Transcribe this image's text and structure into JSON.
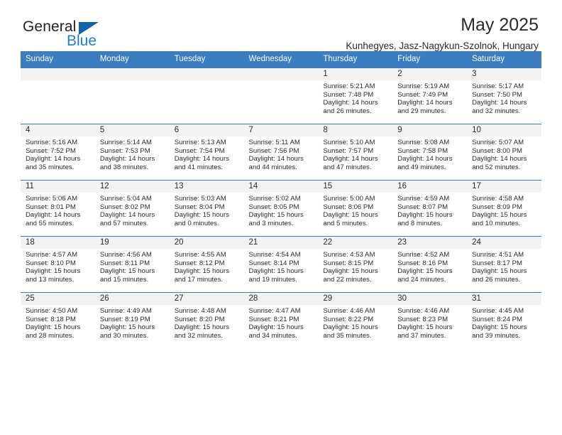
{
  "brand": {
    "name_top": "General",
    "name_bottom": "Blue",
    "accent_color": "#1063a8",
    "blue_text_color": "#1b7fd4"
  },
  "header": {
    "title": "May 2025",
    "location": "Kunhegyes, Jasz-Nagykun-Szolnok, Hungary"
  },
  "calendar": {
    "header_bg": "#3b7dc0",
    "daynum_bg": "#f2f2f2",
    "weekdays": [
      "Sunday",
      "Monday",
      "Tuesday",
      "Wednesday",
      "Thursday",
      "Friday",
      "Saturday"
    ],
    "weeks": [
      [
        {
          "day": "",
          "sunrise": "",
          "sunset": "",
          "daylight_l1": "",
          "daylight_l2": ""
        },
        {
          "day": "",
          "sunrise": "",
          "sunset": "",
          "daylight_l1": "",
          "daylight_l2": ""
        },
        {
          "day": "",
          "sunrise": "",
          "sunset": "",
          "daylight_l1": "",
          "daylight_l2": ""
        },
        {
          "day": "",
          "sunrise": "",
          "sunset": "",
          "daylight_l1": "",
          "daylight_l2": ""
        },
        {
          "day": "1",
          "sunrise": "Sunrise: 5:21 AM",
          "sunset": "Sunset: 7:48 PM",
          "daylight_l1": "Daylight: 14 hours",
          "daylight_l2": "and 26 minutes."
        },
        {
          "day": "2",
          "sunrise": "Sunrise: 5:19 AM",
          "sunset": "Sunset: 7:49 PM",
          "daylight_l1": "Daylight: 14 hours",
          "daylight_l2": "and 29 minutes."
        },
        {
          "day": "3",
          "sunrise": "Sunrise: 5:17 AM",
          "sunset": "Sunset: 7:50 PM",
          "daylight_l1": "Daylight: 14 hours",
          "daylight_l2": "and 32 minutes."
        }
      ],
      [
        {
          "day": "4",
          "sunrise": "Sunrise: 5:16 AM",
          "sunset": "Sunset: 7:52 PM",
          "daylight_l1": "Daylight: 14 hours",
          "daylight_l2": "and 35 minutes."
        },
        {
          "day": "5",
          "sunrise": "Sunrise: 5:14 AM",
          "sunset": "Sunset: 7:53 PM",
          "daylight_l1": "Daylight: 14 hours",
          "daylight_l2": "and 38 minutes."
        },
        {
          "day": "6",
          "sunrise": "Sunrise: 5:13 AM",
          "sunset": "Sunset: 7:54 PM",
          "daylight_l1": "Daylight: 14 hours",
          "daylight_l2": "and 41 minutes."
        },
        {
          "day": "7",
          "sunrise": "Sunrise: 5:11 AM",
          "sunset": "Sunset: 7:56 PM",
          "daylight_l1": "Daylight: 14 hours",
          "daylight_l2": "and 44 minutes."
        },
        {
          "day": "8",
          "sunrise": "Sunrise: 5:10 AM",
          "sunset": "Sunset: 7:57 PM",
          "daylight_l1": "Daylight: 14 hours",
          "daylight_l2": "and 47 minutes."
        },
        {
          "day": "9",
          "sunrise": "Sunrise: 5:08 AM",
          "sunset": "Sunset: 7:58 PM",
          "daylight_l1": "Daylight: 14 hours",
          "daylight_l2": "and 49 minutes."
        },
        {
          "day": "10",
          "sunrise": "Sunrise: 5:07 AM",
          "sunset": "Sunset: 8:00 PM",
          "daylight_l1": "Daylight: 14 hours",
          "daylight_l2": "and 52 minutes."
        }
      ],
      [
        {
          "day": "11",
          "sunrise": "Sunrise: 5:06 AM",
          "sunset": "Sunset: 8:01 PM",
          "daylight_l1": "Daylight: 14 hours",
          "daylight_l2": "and 55 minutes."
        },
        {
          "day": "12",
          "sunrise": "Sunrise: 5:04 AM",
          "sunset": "Sunset: 8:02 PM",
          "daylight_l1": "Daylight: 14 hours",
          "daylight_l2": "and 57 minutes."
        },
        {
          "day": "13",
          "sunrise": "Sunrise: 5:03 AM",
          "sunset": "Sunset: 8:04 PM",
          "daylight_l1": "Daylight: 15 hours",
          "daylight_l2": "and 0 minutes."
        },
        {
          "day": "14",
          "sunrise": "Sunrise: 5:02 AM",
          "sunset": "Sunset: 8:05 PM",
          "daylight_l1": "Daylight: 15 hours",
          "daylight_l2": "and 3 minutes."
        },
        {
          "day": "15",
          "sunrise": "Sunrise: 5:00 AM",
          "sunset": "Sunset: 8:06 PM",
          "daylight_l1": "Daylight: 15 hours",
          "daylight_l2": "and 5 minutes."
        },
        {
          "day": "16",
          "sunrise": "Sunrise: 4:59 AM",
          "sunset": "Sunset: 8:07 PM",
          "daylight_l1": "Daylight: 15 hours",
          "daylight_l2": "and 8 minutes."
        },
        {
          "day": "17",
          "sunrise": "Sunrise: 4:58 AM",
          "sunset": "Sunset: 8:09 PM",
          "daylight_l1": "Daylight: 15 hours",
          "daylight_l2": "and 10 minutes."
        }
      ],
      [
        {
          "day": "18",
          "sunrise": "Sunrise: 4:57 AM",
          "sunset": "Sunset: 8:10 PM",
          "daylight_l1": "Daylight: 15 hours",
          "daylight_l2": "and 13 minutes."
        },
        {
          "day": "19",
          "sunrise": "Sunrise: 4:56 AM",
          "sunset": "Sunset: 8:11 PM",
          "daylight_l1": "Daylight: 15 hours",
          "daylight_l2": "and 15 minutes."
        },
        {
          "day": "20",
          "sunrise": "Sunrise: 4:55 AM",
          "sunset": "Sunset: 8:12 PM",
          "daylight_l1": "Daylight: 15 hours",
          "daylight_l2": "and 17 minutes."
        },
        {
          "day": "21",
          "sunrise": "Sunrise: 4:54 AM",
          "sunset": "Sunset: 8:14 PM",
          "daylight_l1": "Daylight: 15 hours",
          "daylight_l2": "and 19 minutes."
        },
        {
          "day": "22",
          "sunrise": "Sunrise: 4:53 AM",
          "sunset": "Sunset: 8:15 PM",
          "daylight_l1": "Daylight: 15 hours",
          "daylight_l2": "and 22 minutes."
        },
        {
          "day": "23",
          "sunrise": "Sunrise: 4:52 AM",
          "sunset": "Sunset: 8:16 PM",
          "daylight_l1": "Daylight: 15 hours",
          "daylight_l2": "and 24 minutes."
        },
        {
          "day": "24",
          "sunrise": "Sunrise: 4:51 AM",
          "sunset": "Sunset: 8:17 PM",
          "daylight_l1": "Daylight: 15 hours",
          "daylight_l2": "and 26 minutes."
        }
      ],
      [
        {
          "day": "25",
          "sunrise": "Sunrise: 4:50 AM",
          "sunset": "Sunset: 8:18 PM",
          "daylight_l1": "Daylight: 15 hours",
          "daylight_l2": "and 28 minutes."
        },
        {
          "day": "26",
          "sunrise": "Sunrise: 4:49 AM",
          "sunset": "Sunset: 8:19 PM",
          "daylight_l1": "Daylight: 15 hours",
          "daylight_l2": "and 30 minutes."
        },
        {
          "day": "27",
          "sunrise": "Sunrise: 4:48 AM",
          "sunset": "Sunset: 8:20 PM",
          "daylight_l1": "Daylight: 15 hours",
          "daylight_l2": "and 32 minutes."
        },
        {
          "day": "28",
          "sunrise": "Sunrise: 4:47 AM",
          "sunset": "Sunset: 8:21 PM",
          "daylight_l1": "Daylight: 15 hours",
          "daylight_l2": "and 34 minutes."
        },
        {
          "day": "29",
          "sunrise": "Sunrise: 4:46 AM",
          "sunset": "Sunset: 8:22 PM",
          "daylight_l1": "Daylight: 15 hours",
          "daylight_l2": "and 35 minutes."
        },
        {
          "day": "30",
          "sunrise": "Sunrise: 4:46 AM",
          "sunset": "Sunset: 8:23 PM",
          "daylight_l1": "Daylight: 15 hours",
          "daylight_l2": "and 37 minutes."
        },
        {
          "day": "31",
          "sunrise": "Sunrise: 4:45 AM",
          "sunset": "Sunset: 8:24 PM",
          "daylight_l1": "Daylight: 15 hours",
          "daylight_l2": "and 39 minutes."
        }
      ]
    ]
  }
}
